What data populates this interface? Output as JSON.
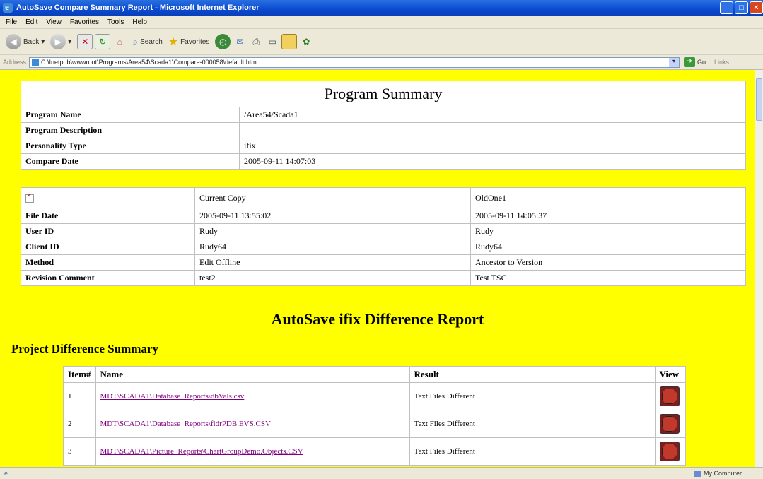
{
  "window": {
    "title": "AutoSave Compare Summary Report - Microsoft Internet Explorer"
  },
  "menu": [
    "File",
    "Edit",
    "View",
    "Favorites",
    "Tools",
    "Help"
  ],
  "toolbar": {
    "back_label": "Back",
    "search_label": "Search",
    "favorites_label": "Favorites"
  },
  "address": {
    "label": "Address",
    "url": "C:\\Inetpub\\wwwroot\\Programs\\Area54\\Scada1\\Compare-000058\\default.htm",
    "go_label": "Go",
    "links_label": "Links"
  },
  "summary": {
    "header": "Program Summary",
    "rows": [
      {
        "label": "Program Name",
        "value": "/Area54/Scada1"
      },
      {
        "label": "Program Description",
        "value": ""
      },
      {
        "label": "Personality Type",
        "value": "ifix"
      },
      {
        "label": "Compare Date",
        "value": "2005-09-11 14:07:03"
      }
    ]
  },
  "copies": {
    "col_current": "Current Copy",
    "col_old": "OldOne1",
    "rows": [
      {
        "label": "File Date",
        "current": "2005-09-11 13:55:02",
        "old": "2005-09-11 14:05:37"
      },
      {
        "label": "User ID",
        "current": "Rudy",
        "old": "Rudy"
      },
      {
        "label": "Client ID",
        "current": "Rudy64",
        "old": "Rudy64"
      },
      {
        "label": "Method",
        "current": "Edit Offline",
        "old": "Ancestor to Version"
      },
      {
        "label": "Revision Comment",
        "current": "test2",
        "old": "Test TSC"
      }
    ]
  },
  "report": {
    "title": "AutoSave ifix Difference Report",
    "project_title": "Project Difference Summary"
  },
  "diff": {
    "headers": {
      "item": "Item#",
      "name": "Name",
      "result": "Result",
      "view": "View"
    },
    "rows": [
      {
        "item": "1",
        "name": "MDT\\SCADA1\\Database_Reports\\dbVals.csv",
        "result": "Text Files Different"
      },
      {
        "item": "2",
        "name": "MDT\\SCADA1\\Database_Reports\\fldrPDB.EVS.CSV",
        "result": "Text Files Different"
      },
      {
        "item": "3",
        "name": "MDT\\SCADA1\\Picture_Reports\\ChartGroupDemo.Objects.CSV",
        "result": "Text Files Different"
      }
    ]
  },
  "status": {
    "zone": "My Computer"
  }
}
